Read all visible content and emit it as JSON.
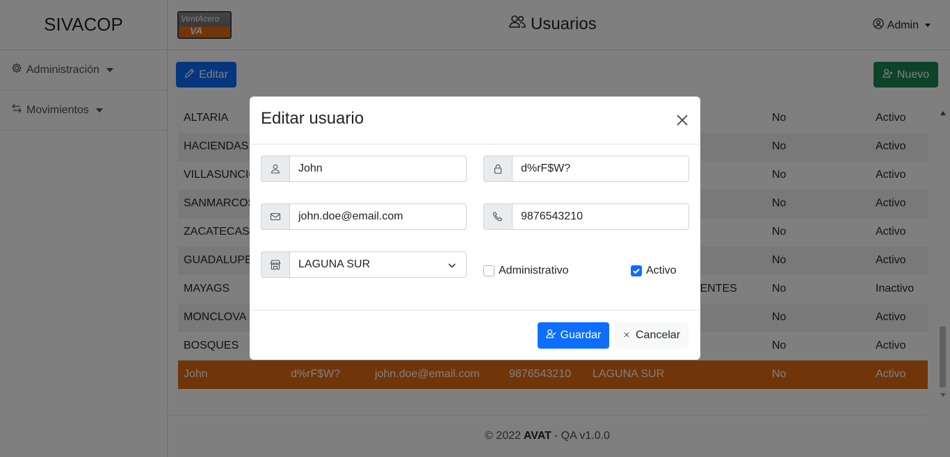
{
  "app": {
    "brand": "SIVACOP"
  },
  "logo": {
    "text_top": "VentAcero",
    "text_bottom": "VA"
  },
  "sidebar": {
    "items": [
      {
        "label": "Administración",
        "icon": "gear-icon"
      },
      {
        "label": "Movimientos",
        "icon": "arrows-exchange-icon"
      }
    ]
  },
  "header": {
    "title": "Usuarios",
    "title_icon": "users-icon",
    "user_label": "Admin"
  },
  "toolbar": {
    "edit_label": "Editar",
    "new_label": "Nuevo"
  },
  "table": {
    "rows": [
      {
        "name": "ALTARIA",
        "password": "",
        "email": "",
        "phone": "",
        "branch": "",
        "admin": "No",
        "status": "Activo"
      },
      {
        "name": "HACIENDAS",
        "password": "",
        "email": "",
        "phone": "",
        "branch": "",
        "admin": "No",
        "status": "Activo"
      },
      {
        "name": "VILLASUNCIO",
        "password": "",
        "email": "",
        "phone": "",
        "branch": "",
        "admin": "No",
        "status": "Activo"
      },
      {
        "name": "SANMARCOS",
        "password": "",
        "email": "",
        "phone": "",
        "branch": "",
        "admin": "No",
        "status": "Activo"
      },
      {
        "name": "ZACATECAS",
        "password": "",
        "email": "",
        "phone": "",
        "branch": "",
        "admin": "No",
        "status": "Activo"
      },
      {
        "name": "GUADALUPE",
        "password": "",
        "email": "",
        "phone": "",
        "branch": "",
        "admin": "No",
        "status": "Activo"
      },
      {
        "name": "MAYAGS",
        "password": "",
        "email": "",
        "phone": "",
        "branch": "IENTES",
        "admin": "No",
        "status": "Inactivo"
      },
      {
        "name": "MONCLOVA",
        "password": "",
        "email": "",
        "phone": "",
        "branch": "",
        "admin": "No",
        "status": "Activo"
      },
      {
        "name": "BOSQUES",
        "password": "",
        "email": "",
        "phone": "",
        "branch": "",
        "admin": "No",
        "status": "Activo"
      },
      {
        "name": "John",
        "password": "d%rF$W?",
        "email": "john.doe@email.com",
        "phone": "9876543210",
        "branch": "LAGUNA SUR",
        "admin": "No",
        "status": "Activo"
      }
    ]
  },
  "footer": {
    "copyright": "© 2022",
    "company": "AVAT",
    "version": "- QA v1.0.0"
  },
  "modal": {
    "title": "Editar usuario",
    "fields": {
      "username": "John",
      "password": "d%rF$W?",
      "email": "john.doe@email.com",
      "phone": "9876543210",
      "branch": "LAGUNA SUR"
    },
    "checks": {
      "admin_label": "Administrativo",
      "admin_checked": false,
      "active_label": "Activo",
      "active_checked": true
    },
    "save_label": "Guardar",
    "cancel_label": "Cancelar"
  },
  "colors": {
    "primary": "#0d6efd",
    "success": "#198754",
    "selected_row": "#e36a14"
  }
}
